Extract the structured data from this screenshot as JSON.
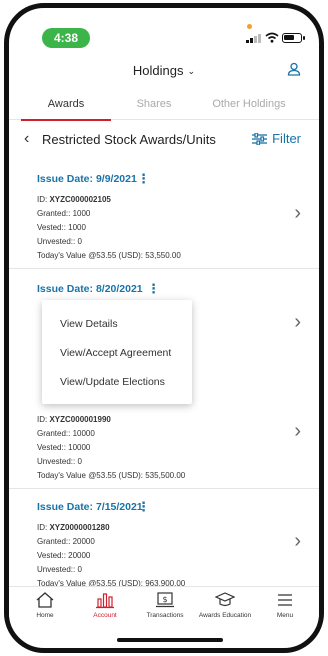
{
  "status_bar": {
    "time": "4:38"
  },
  "header": {
    "title": "Holdings",
    "chevron": "⌄"
  },
  "tabs": [
    {
      "label": "Awards",
      "active": true
    },
    {
      "label": "Shares",
      "active": false
    },
    {
      "label": "Other Holdings",
      "active": false
    }
  ],
  "page": {
    "back": "‹",
    "title": "Restricted Stock Awards/Units",
    "filter_label": "Filter"
  },
  "cards": [
    {
      "issue_date": "Issue Date: 9/9/2021",
      "id_label": "ID:",
      "id_value": "XYZC000002105",
      "granted": "Granted:: 1000",
      "vested": "Vested:: 1000",
      "unvested": "Unvested:: 0",
      "todays_value": "Today's Value @53.55 (USD): 53,550.00"
    },
    {
      "issue_date": "Issue Date: 8/20/2021",
      "id_label": "ID:",
      "id_value": "XYZC000001990",
      "granted": "Granted:: 10000",
      "vested": "Vested:: 10000",
      "unvested": "Unvested:: 0",
      "todays_value": "Today's Value @53.55 (USD): 535,500.00"
    },
    {
      "issue_date": "Issue Date: 7/15/2021",
      "id_label": "ID:",
      "id_value": "XYZ0000001280",
      "granted": "Granted:: 20000",
      "vested": "Vested:: 20000",
      "unvested": "Unvested:: 0",
      "todays_value": "Today's Value @53.55 (USD): 963,900.00"
    }
  ],
  "popup_menu": [
    "View Details",
    "View/Accept Agreement",
    "View/Update Elections"
  ],
  "bottom_nav": [
    {
      "label": "Home",
      "icon": "home-icon",
      "active": false
    },
    {
      "label": "Account",
      "icon": "bar-chart-icon",
      "active": true
    },
    {
      "label": "Transactions",
      "icon": "transactions-icon",
      "active": false
    },
    {
      "label": "Awards Education",
      "icon": "graduation-cap-icon",
      "active": false
    },
    {
      "label": "Menu",
      "icon": "hamburger-menu-icon",
      "active": false
    }
  ],
  "colors": {
    "accent_blue": "#1a73a8",
    "accent_red": "#d0202c",
    "status_green": "#3bb54a"
  }
}
